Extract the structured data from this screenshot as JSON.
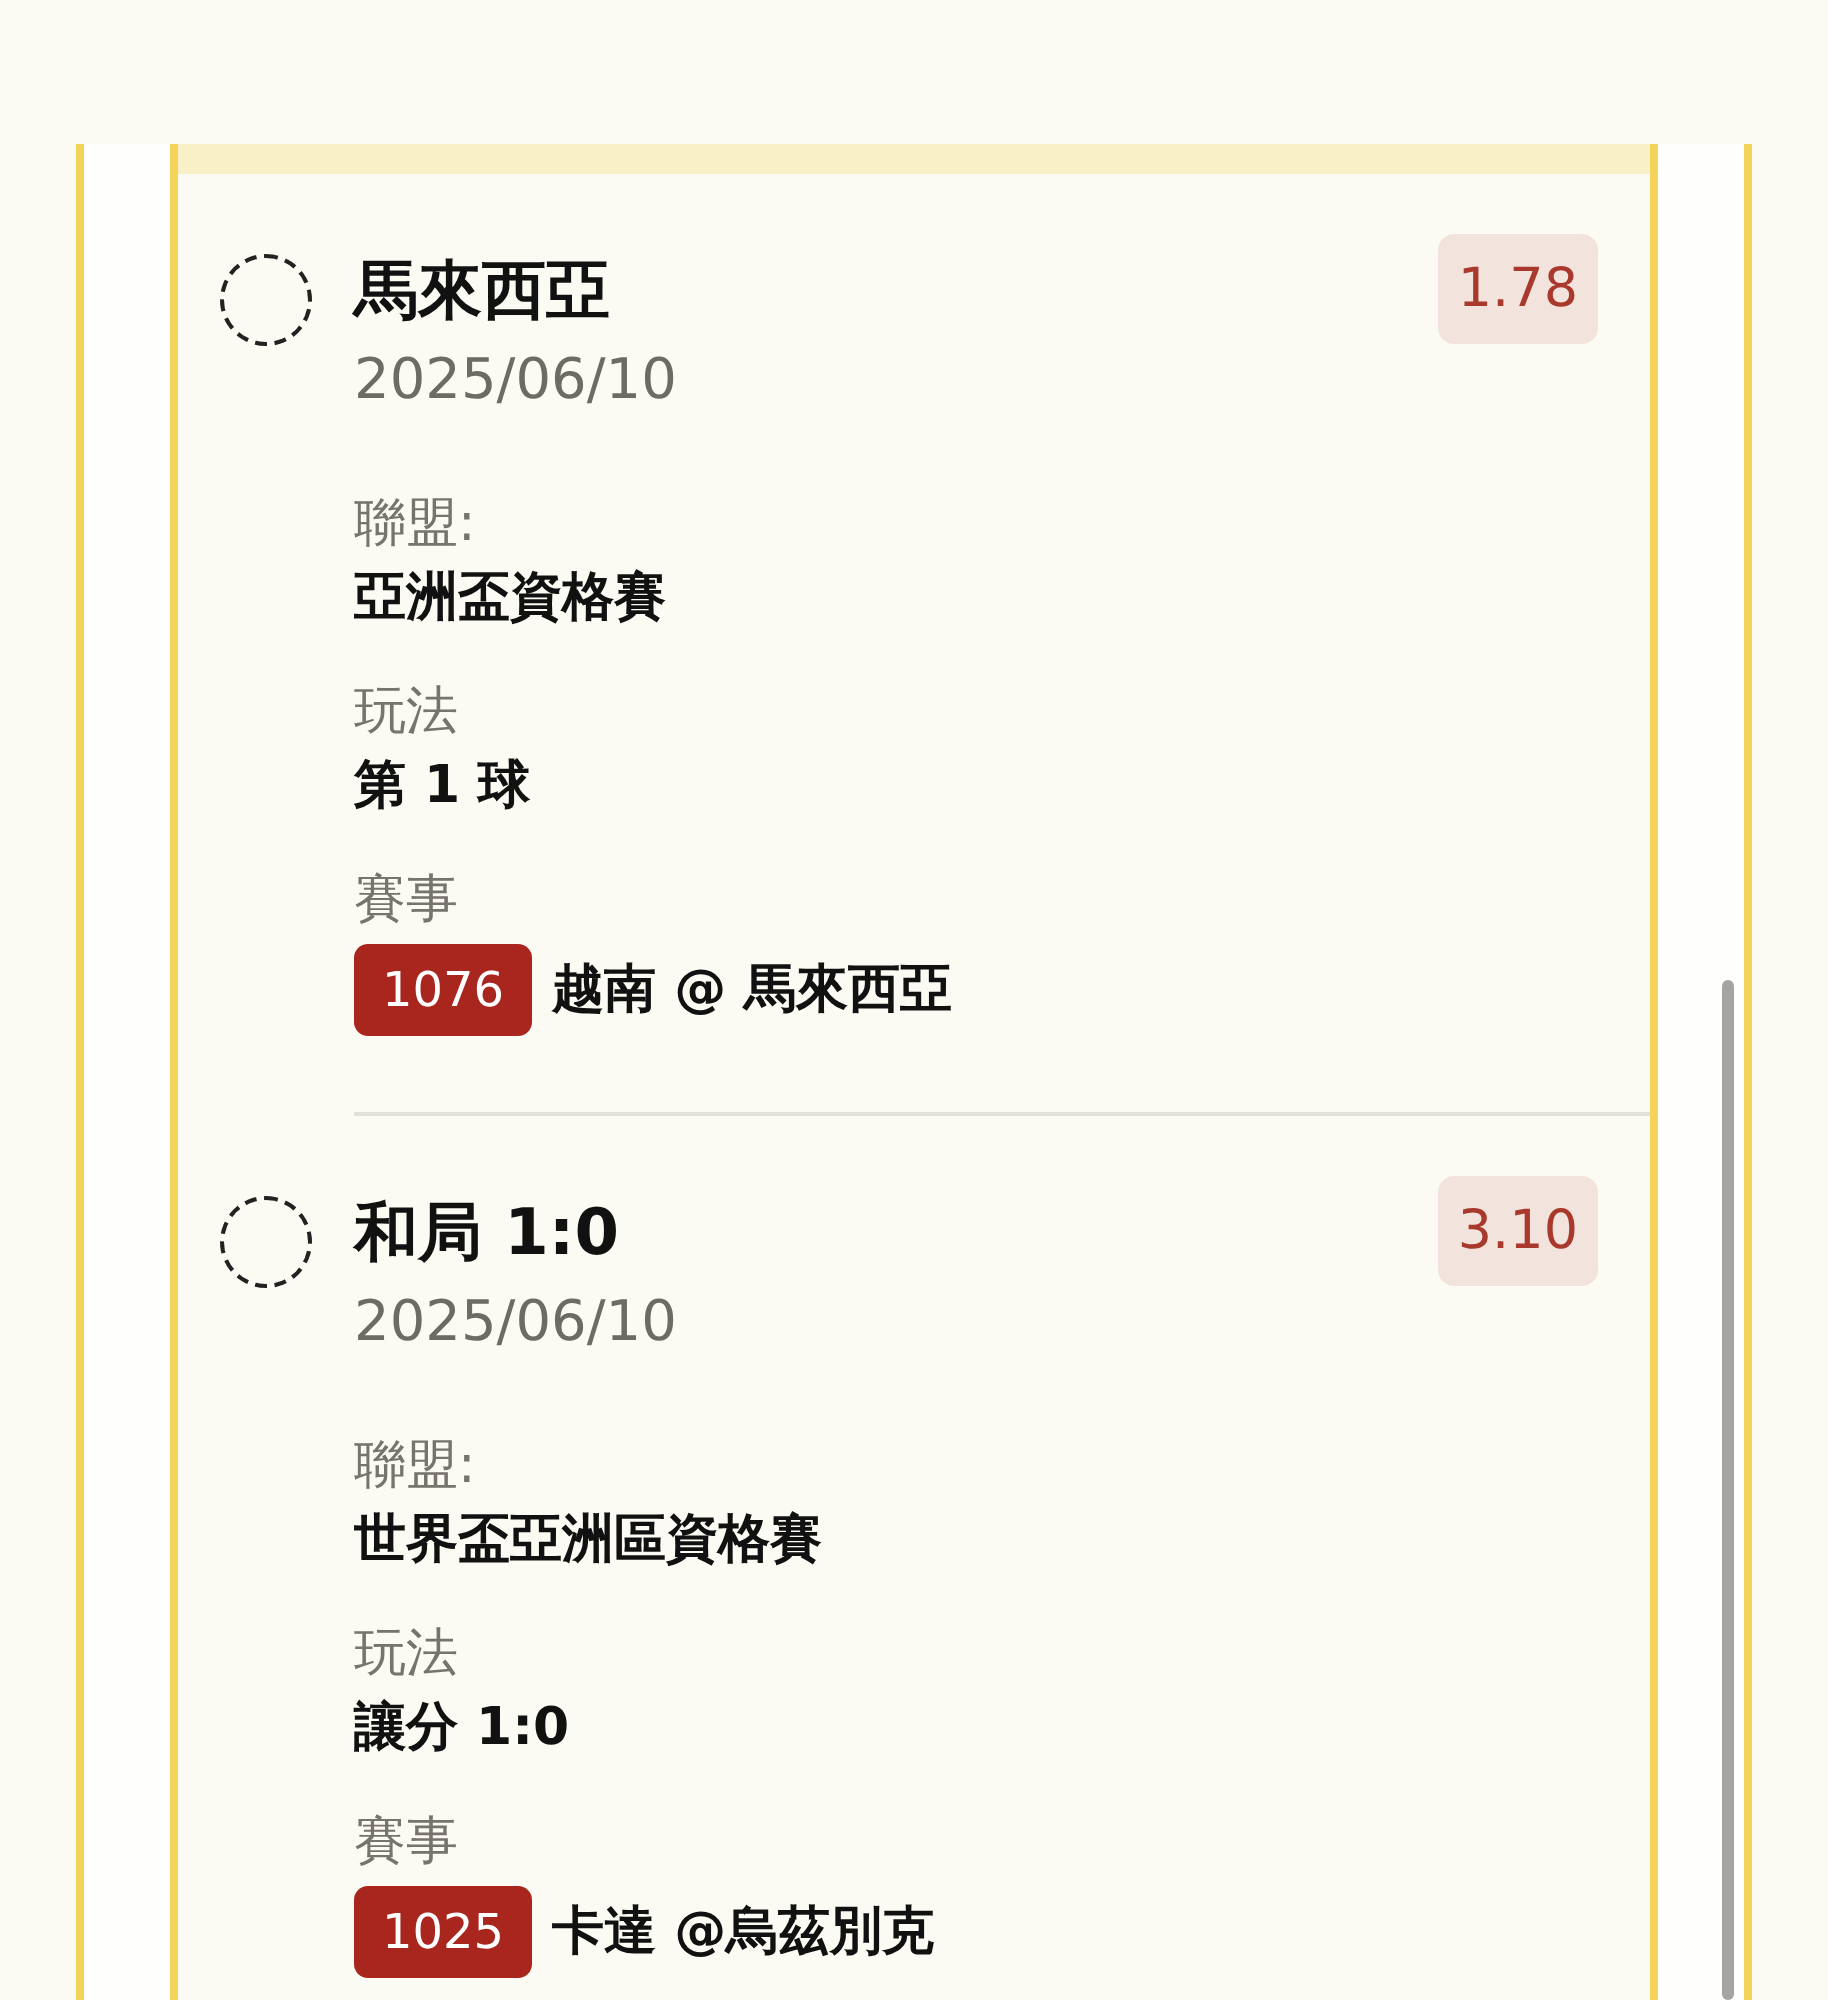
{
  "bets": [
    {
      "selected": false,
      "title": "馬來西亞",
      "date": "2025/06/10",
      "odds": "1.78",
      "fields": [
        {
          "label": "聯盟:",
          "value": "亞洲盃資格賽"
        },
        {
          "label": "玩法",
          "value": "第 1 球"
        }
      ],
      "match_label": "賽事",
      "match_code": "1076",
      "match_name": "越南 @ 馬來西亞"
    },
    {
      "selected": false,
      "title": "和局 1:0",
      "date": "2025/06/10",
      "odds": "3.10",
      "fields": [
        {
          "label": "聯盟:",
          "value": "世界盃亞洲區資格賽"
        },
        {
          "label": "玩法",
          "value": "讓分 1:0"
        }
      ],
      "match_label": "賽事",
      "match_code": "1025",
      "match_name": "卡達 @烏茲別克"
    }
  ]
}
